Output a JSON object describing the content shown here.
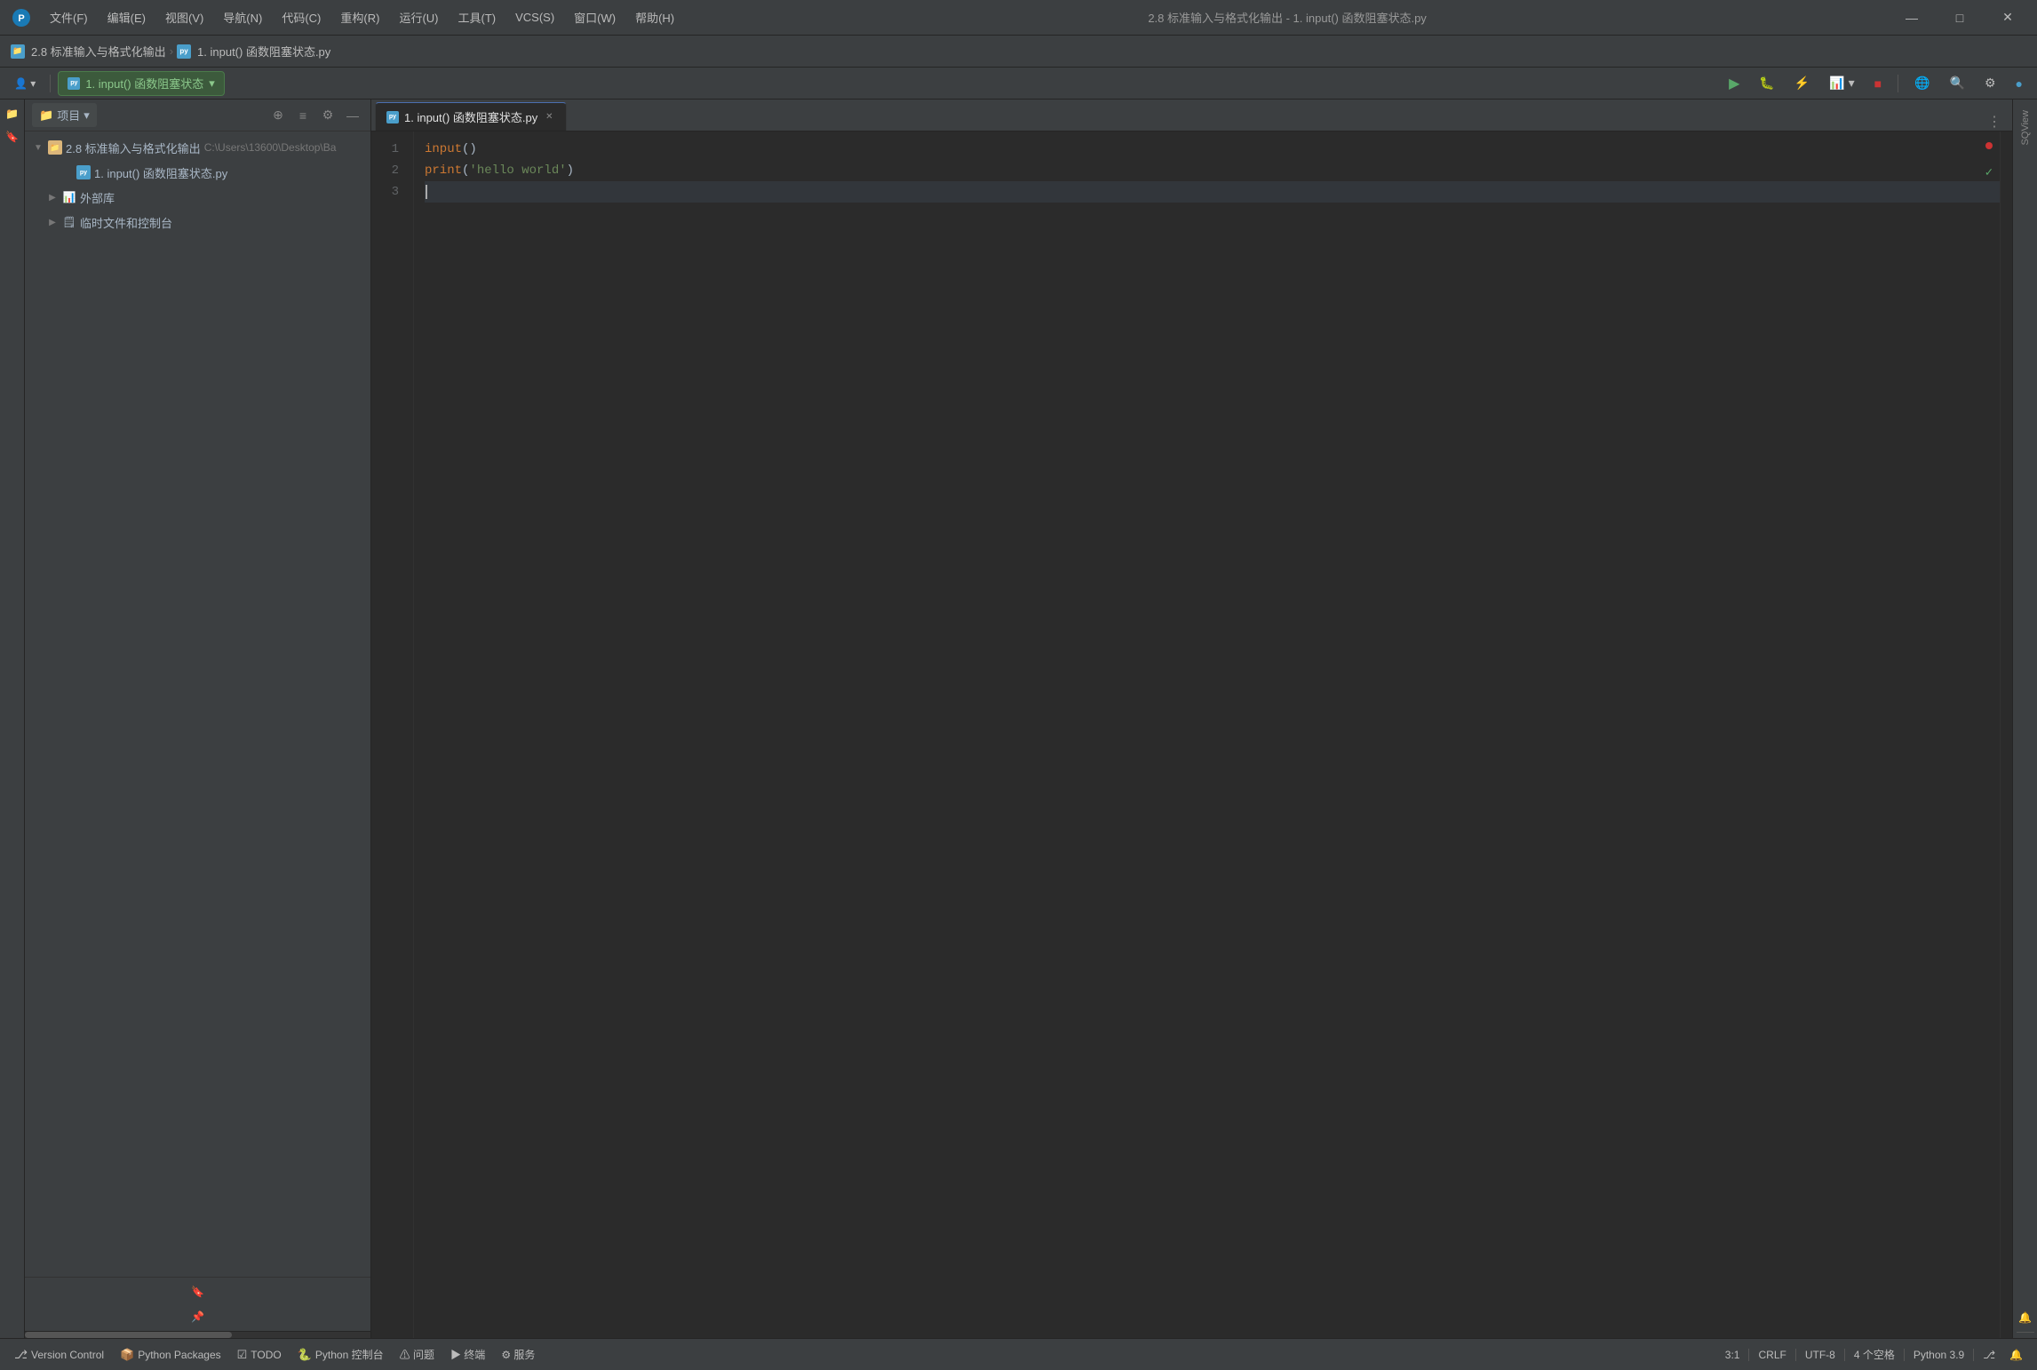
{
  "window": {
    "title": "2.8 标准输入与格式化输出 - 1. input() 函数阻塞状态.py",
    "min_label": "—",
    "max_label": "□",
    "close_label": "✕"
  },
  "menu": {
    "items": [
      "文件(F)",
      "编辑(E)",
      "视图(V)",
      "导航(N)",
      "代码(C)",
      "重构(R)",
      "运行(U)",
      "工具(T)",
      "VCS(S)",
      "窗口(W)",
      "帮助(H)"
    ]
  },
  "breadcrumb": {
    "project": "2.8 标准输入与格式化输出",
    "sep": "›",
    "file": "1. input() 函数阻塞状态.py"
  },
  "toolbar": {
    "interpreter_label": "1. input() 函数阻塞状态",
    "run_label": "▶",
    "icons": [
      "⚙",
      "⟳",
      "🔧",
      "≡",
      "Aa",
      "🔍",
      "⚙",
      "●"
    ]
  },
  "sidebar": {
    "title": "项目",
    "path_text": "C:\\Users\\13600\\Desktop\\Ba",
    "root_folder": "2.8 标准输入与格式化输出",
    "file_node": "1. input() 函数阻塞状态.py",
    "lib_node": "外部库",
    "temp_node": "临时文件和控制台"
  },
  "editor": {
    "tab_label": "1. input() 函数阻塞状态.py",
    "lines": [
      {
        "number": "1",
        "tokens": [
          {
            "text": "input",
            "type": "builtin"
          },
          {
            "text": "()",
            "type": "normal"
          }
        ],
        "has_error": true
      },
      {
        "number": "2",
        "tokens": [
          {
            "text": "print",
            "type": "builtin"
          },
          {
            "text": "(",
            "type": "normal"
          },
          {
            "text": "'hello world'",
            "type": "string"
          },
          {
            "text": ")",
            "type": "normal"
          }
        ],
        "has_ok": true
      },
      {
        "number": "3",
        "tokens": [],
        "is_active": true
      }
    ]
  },
  "right_rail": {
    "label": "SQView"
  },
  "status_bar": {
    "version_control_label": "Version Control",
    "python_packages_label": "Python Packages",
    "todo_label": "TODO",
    "python_console_label": "Python 控制台",
    "problems_label": "⚠ 问题",
    "terminal_label": "▶ 终端",
    "services_label": "⚙ 服务",
    "right_items": {
      "position": "3:1",
      "encoding": "UTF-8",
      "line_ending": "CRLF",
      "indent": "4 个空格",
      "python_version": "Python 3.9",
      "git_icon": "⎇",
      "notification_icon": "🔔"
    }
  }
}
